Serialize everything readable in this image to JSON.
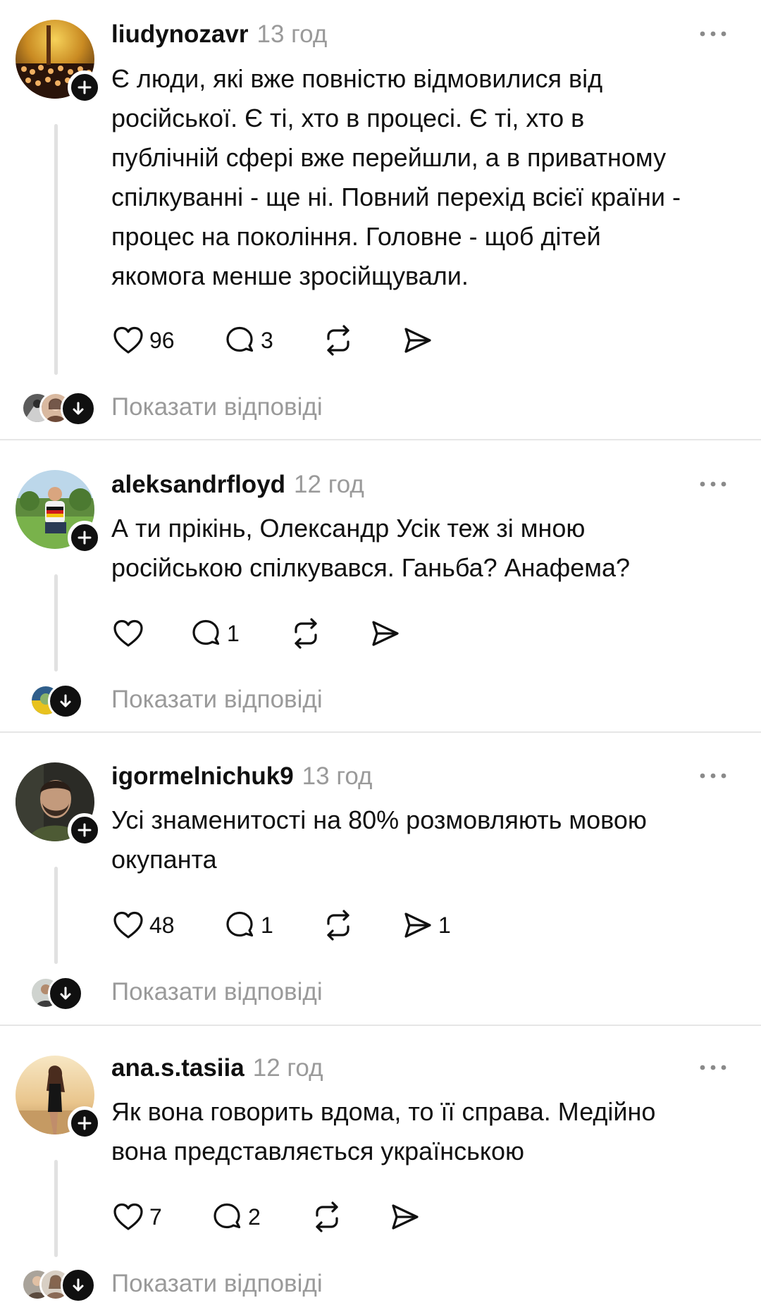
{
  "colors": {
    "text": "#101010",
    "muted": "#9a9a9a",
    "divider": "#e6e6e6",
    "thread_line": "#e1e1e1"
  },
  "posts": [
    {
      "username": "liudynozavr",
      "time": "13 год",
      "lines": [
        "Є люди, які вже повністю відмовилися від",
        "російської. Є ті, хто в процесі. Є ті, хто в",
        "публічній сфері вже перейшли, а в приватному",
        "спілкуванні - ще ні. Повний перехід всієї країни -",
        "процес на покоління. Головне - щоб дітей",
        "якомога менше зросійщували."
      ],
      "likes": "96",
      "comments": "3",
      "reposts": "",
      "shares": "",
      "show_replies": "Показати відповіді"
    },
    {
      "username": "aleksandrfloyd",
      "time": "12 год",
      "lines": [
        "А ти прікінь, Олександр Усік теж зі мною",
        "російською спілкувався. Ганьба? Анафема?"
      ],
      "likes": "",
      "comments": "1",
      "reposts": "",
      "shares": "",
      "show_replies": "Показати відповіді"
    },
    {
      "username": "igormelnichuk9",
      "time": "13 год",
      "lines": [
        "Усі знаменитості на 80% розмовляють мовою",
        "окупанта"
      ],
      "likes": "48",
      "comments": "1",
      "reposts": "",
      "shares": "1",
      "show_replies": "Показати відповіді"
    },
    {
      "username": "ana.s.tasiia",
      "time": "12 год",
      "lines": [
        "Як вона говорить вдома, то її справа. Медійно",
        "вона представляється українською"
      ],
      "likes": "7",
      "comments": "2",
      "reposts": "",
      "shares": "",
      "show_replies": "Показати відповіді"
    }
  ],
  "icons": {
    "like": "heart-icon",
    "comment": "comment-bubble-icon",
    "repost": "repost-icon",
    "share": "send-icon",
    "more": "more-dots-icon",
    "follow": "plus-icon",
    "expand": "arrow-down-icon"
  }
}
